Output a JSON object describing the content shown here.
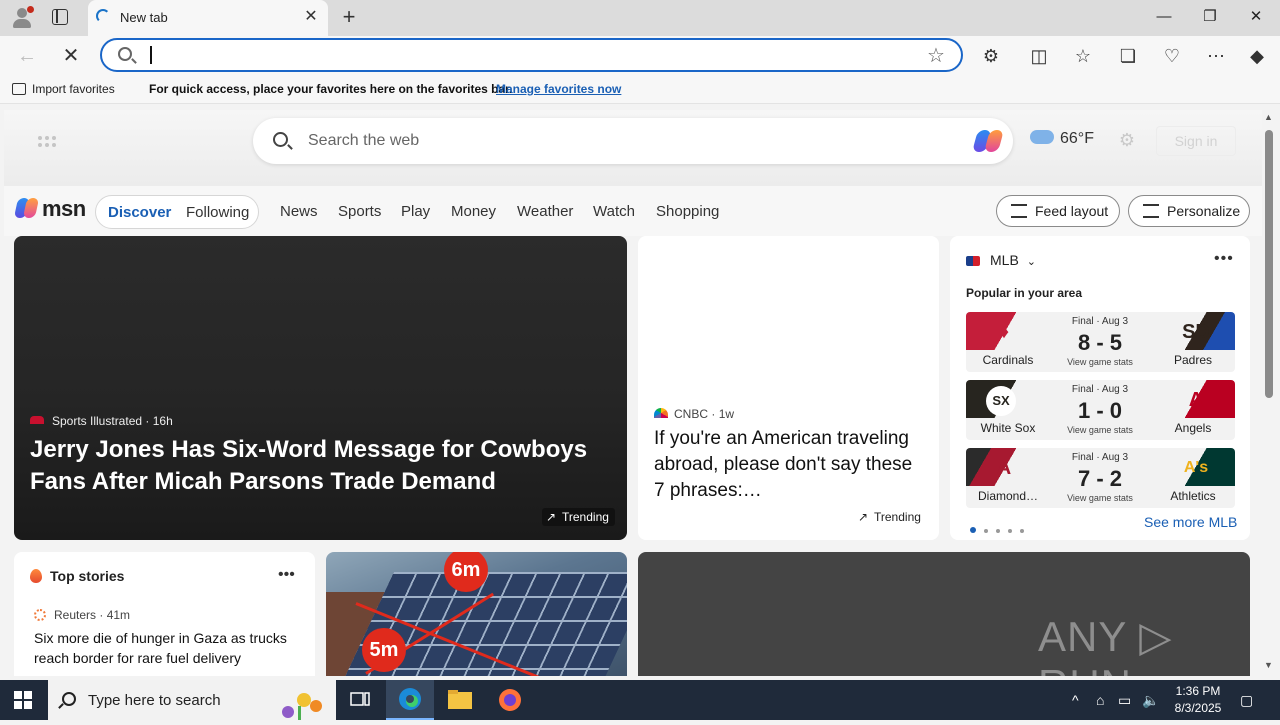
{
  "browser": {
    "tab_title": "New tab",
    "new_tab_glyph": "+",
    "close_glyph": "✕",
    "window_controls": {
      "minimize": "—",
      "restore": "❐",
      "close": "✕"
    },
    "address_value": "",
    "favorites_import": "Import favorites",
    "favorites_hint": "For quick access, place your favorites here on the favorites bar.",
    "favorites_manage": "Manage favorites now"
  },
  "header": {
    "search_placeholder": "Search the web",
    "weather_temp": "66°F",
    "sign_in": "Sign in"
  },
  "nav": {
    "logo_text": "msn",
    "discover": "Discover",
    "following": "Following",
    "links": [
      "News",
      "Sports",
      "Play",
      "Money",
      "Weather",
      "Watch",
      "Shopping"
    ],
    "feed_layout": "Feed layout",
    "personalize": "Personalize"
  },
  "hero": {
    "source": "Sports Illustrated",
    "age": "16h",
    "title": "Jerry Jones Has Six-Word Message for Cowboys Fans After Micah Parsons Trade Demand",
    "badge": "Trending"
  },
  "cnbc": {
    "source": "CNBC",
    "age": "1w",
    "title": "If you're an American traveling abroad, please don't say these 7 phrases:…",
    "badge": "Trending"
  },
  "mlb": {
    "title": "MLB",
    "subtitle": "Popular in your area",
    "games": [
      {
        "status": "Final · Aug 3",
        "score": "8 - 5",
        "stats": "View game stats",
        "home": "Cardinals",
        "away": "Padres",
        "home_color": "#c41e3a",
        "away_color": "#2f241d",
        "home_mark": "♦",
        "away_mark": "SD"
      },
      {
        "status": "Final · Aug 3",
        "score": "1 - 0",
        "stats": "View game stats",
        "home": "White Sox",
        "away": "Angels",
        "home_color": "#27251f",
        "away_color": "#ba0021",
        "home_mark": "SX",
        "away_mark": "A"
      },
      {
        "status": "Final · Aug 3",
        "score": "7 - 2",
        "stats": "View game stats",
        "home": "Diamond…",
        "away": "Athletics",
        "home_color": "#a71930",
        "away_color": "#003831",
        "home_mark": "A",
        "away_mark": "A's"
      }
    ],
    "see_more": "See more MLB"
  },
  "top_stories": {
    "title": "Top stories",
    "source": "Reuters",
    "age": "41m",
    "headline": "Six more die of hunger in Gaza as trucks reach border for rare fuel delivery"
  },
  "solar": {
    "label_a": "6m",
    "label_b": "5m"
  },
  "watermark": "ANY ▷ RUN",
  "taskbar": {
    "search_placeholder": "Type here to search",
    "time": "1:36 PM",
    "date": "8/3/2025"
  }
}
